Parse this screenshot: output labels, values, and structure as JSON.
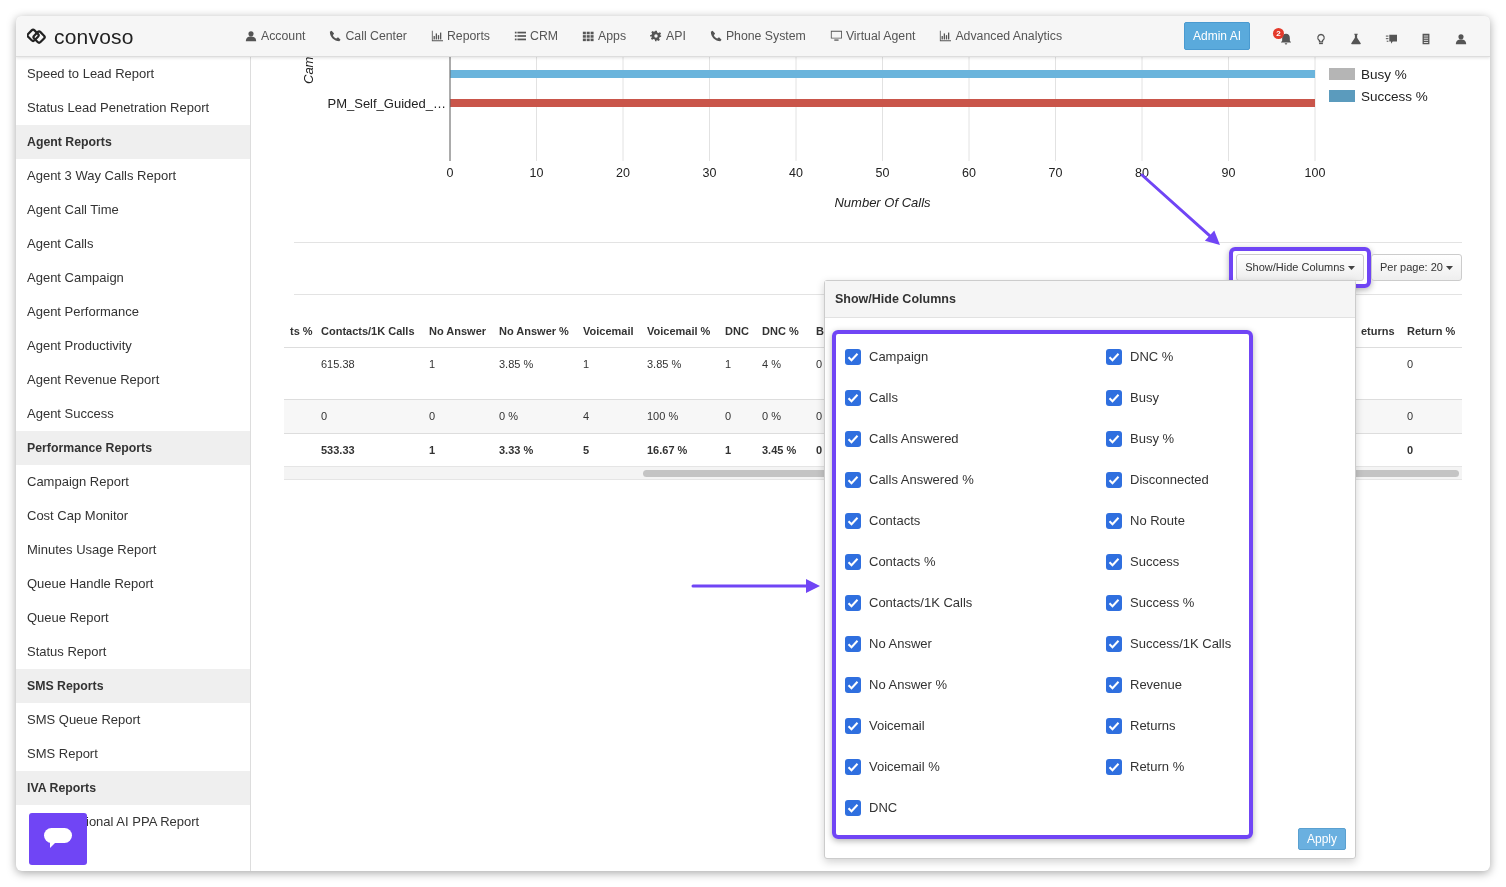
{
  "navbar": {
    "logo": "convoso",
    "items": [
      {
        "label": "Account"
      },
      {
        "label": "Call Center"
      },
      {
        "label": "Reports"
      },
      {
        "label": "CRM"
      },
      {
        "label": "Apps"
      },
      {
        "label": "API"
      },
      {
        "label": "Phone System"
      },
      {
        "label": "Virtual Agent"
      },
      {
        "label": "Advanced Analytics"
      }
    ],
    "admin_button": "Admin AI",
    "notification_count": "2"
  },
  "sidebar": {
    "items": [
      {
        "kind": "link",
        "label": "Speed to Lead Report"
      },
      {
        "kind": "link",
        "label": "Status Lead Penetration Report"
      },
      {
        "kind": "header",
        "label": "Agent Reports"
      },
      {
        "kind": "link",
        "label": "Agent 3 Way Calls Report"
      },
      {
        "kind": "link",
        "label": "Agent Call Time"
      },
      {
        "kind": "link",
        "label": "Agent Calls"
      },
      {
        "kind": "link",
        "label": "Agent Campaign"
      },
      {
        "kind": "link",
        "label": "Agent Performance"
      },
      {
        "kind": "link",
        "label": "Agent Productivity"
      },
      {
        "kind": "link",
        "label": "Agent Revenue Report"
      },
      {
        "kind": "link",
        "label": "Agent Success"
      },
      {
        "kind": "header",
        "label": "Performance Reports"
      },
      {
        "kind": "link",
        "label": "Campaign Report"
      },
      {
        "kind": "link",
        "label": "Cost Cap Monitor"
      },
      {
        "kind": "link",
        "label": "Minutes Usage Report"
      },
      {
        "kind": "link",
        "label": "Queue Handle Report"
      },
      {
        "kind": "link",
        "label": "Queue Report"
      },
      {
        "kind": "link",
        "label": "Status Report"
      },
      {
        "kind": "header",
        "label": "SMS Reports"
      },
      {
        "kind": "link",
        "label": "SMS Queue Report"
      },
      {
        "kind": "link",
        "label": "SMS Report"
      },
      {
        "kind": "header",
        "label": "IVA Reports"
      },
      {
        "kind": "link",
        "label": "ional AI PPA Report"
      }
    ]
  },
  "chart": {
    "chart_data": {
      "type": "bar",
      "orientation": "horizontal",
      "xlabel": "Number Of Calls",
      "ylabel": "Cam",
      "categories": [
        "PM_Self_Guided_…"
      ],
      "series": [
        {
          "color": "#6ab4dc",
          "values": [
            100
          ]
        },
        {
          "color": "#c9554a",
          "values": [
            100
          ]
        }
      ],
      "grid": true,
      "xlim": [
        0,
        100
      ],
      "xticks": [
        0,
        10,
        20,
        30,
        40,
        50,
        60,
        70,
        80,
        90,
        100
      ]
    },
    "legend": [
      {
        "label": "Busy %",
        "color": "#b5b5b5"
      },
      {
        "label": "Success %",
        "color": "#5b9bbd"
      }
    ]
  },
  "toolbar": {
    "columns_button": "Show/Hide Columns",
    "per_page_button": "Per page: 20"
  },
  "table": {
    "columns": [
      "ts %",
      "Contacts/1K Calls",
      "No Answer",
      "No Answer %",
      "Voicemail",
      "Voicemail %",
      "DNC",
      "DNC %",
      "B",
      "eturns",
      "Return %"
    ],
    "rows": [
      {
        "kind": "normal",
        "cells": [
          null,
          "615.38",
          "1",
          "3.85 %",
          "1",
          "3.85 %",
          "1",
          "4 %",
          "0",
          null,
          "0"
        ]
      },
      {
        "kind": "shaded",
        "cells": [
          null,
          "0",
          "0",
          "0 %",
          "4",
          "100 %",
          "0",
          "0 %",
          "0",
          null,
          "0"
        ]
      },
      {
        "kind": "total",
        "cells": [
          null,
          "533.33",
          "1",
          "3.33 %",
          "5",
          "16.67 %",
          "1",
          "3.45 %",
          "0",
          null,
          "0"
        ]
      }
    ]
  },
  "columns_popup": {
    "title": "Show/Hide Columns",
    "apply_button": "Apply",
    "options": [
      {
        "label": "Campaign",
        "checked": true
      },
      {
        "label": "Calls",
        "checked": true
      },
      {
        "label": "Calls Answered",
        "checked": true
      },
      {
        "label": "Calls Answered %",
        "checked": true
      },
      {
        "label": "Contacts",
        "checked": true
      },
      {
        "label": "Contacts %",
        "checked": true
      },
      {
        "label": "Contacts/1K Calls",
        "checked": true
      },
      {
        "label": "No Answer",
        "checked": true
      },
      {
        "label": "No Answer %",
        "checked": true
      },
      {
        "label": "Voicemail",
        "checked": true
      },
      {
        "label": "Voicemail %",
        "checked": true
      },
      {
        "label": "DNC",
        "checked": true
      },
      {
        "label": "DNC %",
        "checked": true
      },
      {
        "label": "Busy",
        "checked": true
      },
      {
        "label": "Busy %",
        "checked": true
      },
      {
        "label": "Disconnected",
        "checked": true
      },
      {
        "label": "No Route",
        "checked": true
      },
      {
        "label": "Success",
        "checked": true
      },
      {
        "label": "Success %",
        "checked": true
      },
      {
        "label": "Success/1K Calls",
        "checked": true
      },
      {
        "label": "Revenue",
        "checked": true
      },
      {
        "label": "Returns",
        "checked": true
      },
      {
        "label": "Return %",
        "checked": true
      }
    ]
  }
}
